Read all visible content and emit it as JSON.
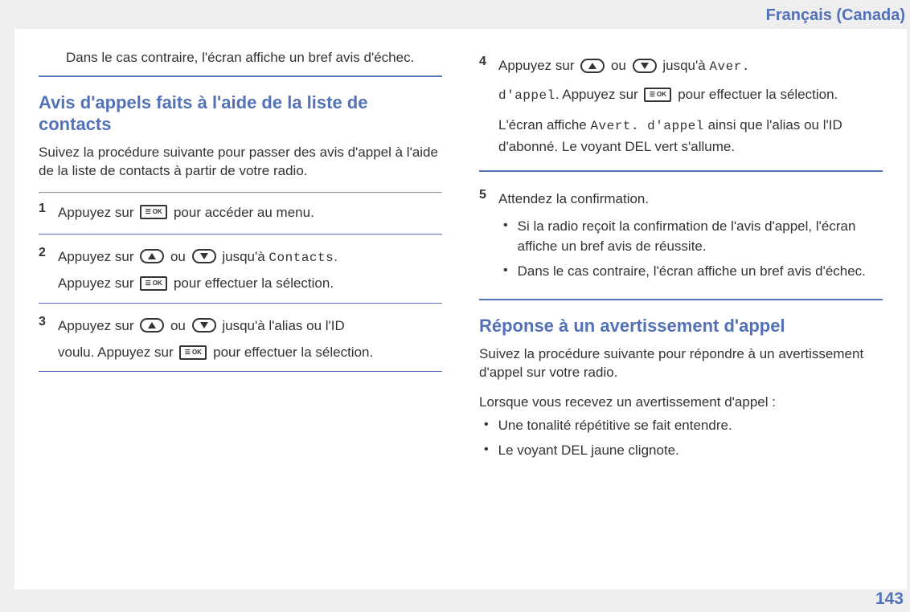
{
  "header": {
    "language": "Français (Canada)"
  },
  "page_number": "143",
  "left": {
    "lead_in": "Dans le cas contraire, l'écran affiche un bref avis d'échec.",
    "section_title": "Avis d'appels faits à l'aide de la liste de contacts",
    "intro": "Suivez la procédure suivante pour passer des avis d'appel à l'aide de la liste de contacts à partir de votre radio.",
    "steps": {
      "s1": {
        "num": "1",
        "a": "Appuyez sur ",
        "b": " pour accéder au menu."
      },
      "s2": {
        "num": "2",
        "a": "Appuyez sur ",
        "b": " ou ",
        "c": " jusqu'à ",
        "mono": "Contacts",
        "d": ".",
        "e": "Appuyez sur ",
        "f": " pour effectuer la sélection."
      },
      "s3": {
        "num": "3",
        "a": "Appuyez sur ",
        "b": " ou ",
        "c": " jusqu'à l'alias ou l'ID",
        "d": "voulu. Appuyez sur ",
        "e": " pour effectuer la sélection."
      }
    }
  },
  "right": {
    "steps": {
      "s4": {
        "num": "4",
        "a": "Appuyez sur ",
        "b": " ou ",
        "c": " jusqu'à ",
        "mono1": "Aver.",
        "d_mono": "d'appel",
        "d2": ". Appuyez sur ",
        "e": " pour effectuer la sélection.",
        "f": "L'écran affiche ",
        "mono2": "Avert. d'appel",
        "g": " ainsi que l'alias ou l'ID d'abonné. Le voyant DEL vert s'allume."
      },
      "s5": {
        "num": "5",
        "a": "Attendez la confirmation.",
        "bullet1": "Si la radio reçoit la confirmation de l'avis d'appel, l'écran affiche un bref avis de réussite.",
        "bullet2": "Dans le cas contraire, l'écran affiche un bref avis d'échec."
      }
    },
    "section2_title": "Réponse à un avertissement d'appel",
    "section2_intro": "Suivez la procédure suivante pour répondre à un avertissement d'appel sur votre radio.",
    "section2_line": "Lorsque vous recevez un avertissement d'appel :",
    "section2_bullets": {
      "b1": "Une tonalité répétitive se fait entendre.",
      "b2": "Le voyant DEL jaune clignote."
    }
  }
}
